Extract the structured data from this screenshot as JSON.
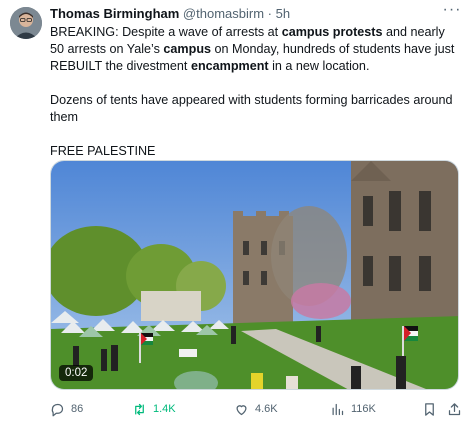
{
  "tweet": {
    "author_name": "Thomas Birmingham",
    "handle": "@thomasbirm",
    "separator": "·",
    "time": "5h",
    "p1": {
      "t1": "BREAKING: Despite a wave of arrests at ",
      "b1": "campus protests",
      "t2": " and nearly 50 arrests on Yale’s ",
      "b2": "campus",
      "t3": " on Monday, hundreds of students have just REBUILT the divestment ",
      "b3": "encampment",
      "t4": " in a new location."
    },
    "p2": "Dozens of tents have appeared with students forming barricades around them",
    "p3": "FREE PALESTINE"
  },
  "media": {
    "duration": "0:02"
  },
  "actions": {
    "replies": "86",
    "reposts": "1.4K",
    "likes": "4.6K",
    "views": "116K"
  },
  "colors": {
    "text": "#0f1419",
    "secondary": "#536471",
    "repost_active": "#00ba7c",
    "border": "#cfd9de"
  },
  "icons": [
    "more-icon",
    "reply-icon",
    "repost-icon",
    "like-icon",
    "views-icon",
    "bookmark-icon",
    "share-icon"
  ]
}
